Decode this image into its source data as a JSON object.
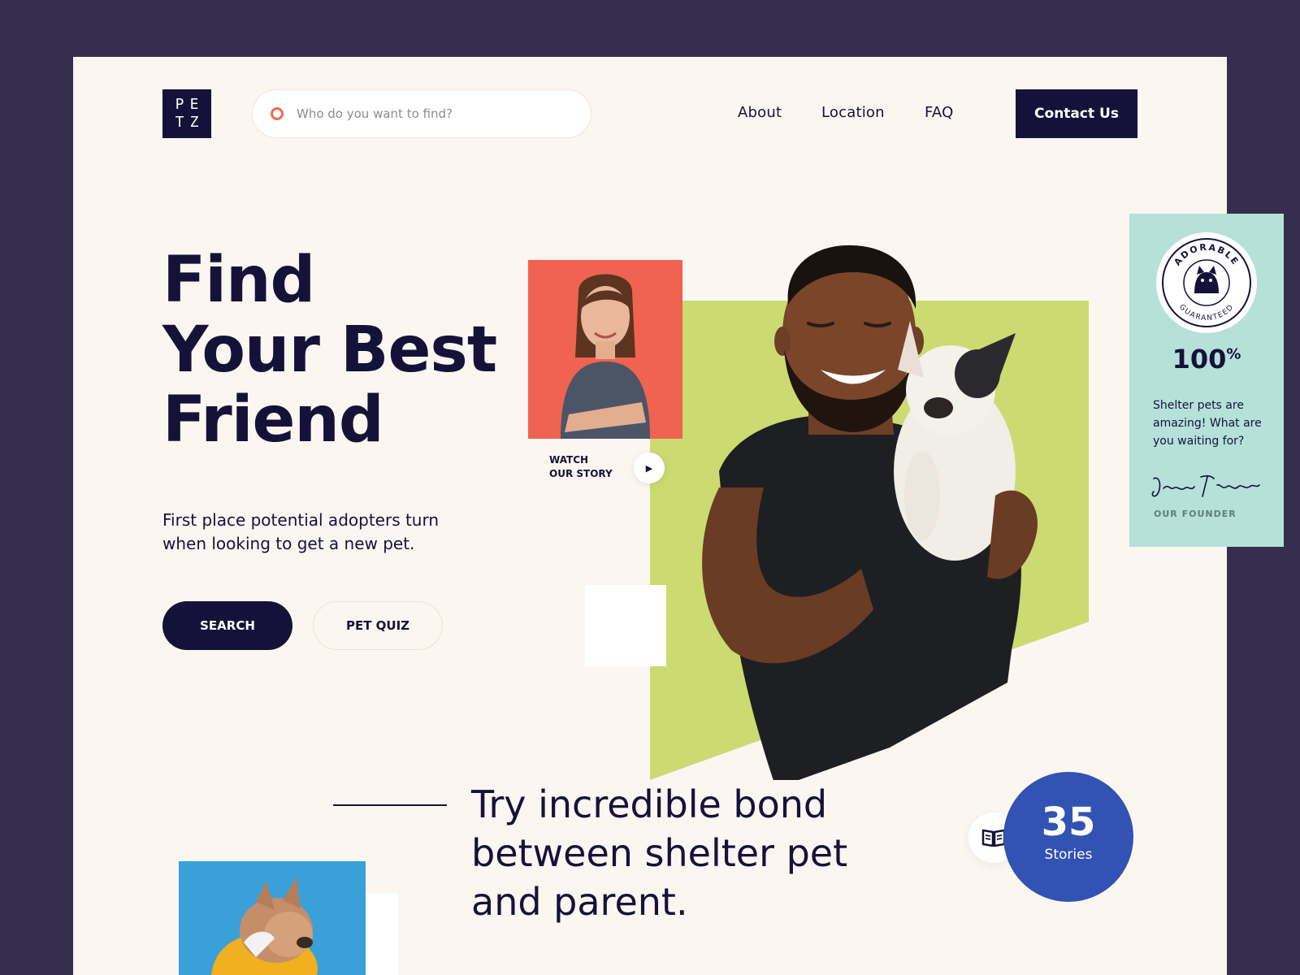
{
  "header": {
    "logo_letters": [
      "P",
      "E",
      "T",
      "Z"
    ],
    "search_placeholder": "Who do you want to find?",
    "nav": [
      "About",
      "Location",
      "FAQ"
    ],
    "contact_label": "Contact Us"
  },
  "hero": {
    "title_lines": [
      "Find",
      "Your Best",
      "Friend"
    ],
    "subtitle": "First place potential adopters turn when looking to get a new pet.",
    "search_button": "SEARCH",
    "quiz_button": "PET QUIZ",
    "watch_line1": "WATCH",
    "watch_line2": "OUR STORY"
  },
  "badge": {
    "stamp_top": "ADORABLE",
    "stamp_bottom": "GUARANTEED",
    "percent": "100",
    "percent_sign": "%",
    "quote": "Shelter pets are amazing! What are you waiting for?",
    "signature": "Jenny Filgram",
    "founder_label": "OUR FOUNDER"
  },
  "bottom": {
    "tagline": "Try incredible bond between shelter pet and parent.",
    "stories_count": "35",
    "stories_label": "Stories"
  },
  "colors": {
    "background": "#352e4f",
    "page": "#fbf6f0",
    "navy": "#15123a",
    "coral": "#ef6350",
    "lime": "#cbdb72",
    "mint": "#b5e1d8",
    "blue": "#3253b3"
  },
  "icons": [
    "search-ring-icon",
    "play-icon",
    "book-icon"
  ]
}
